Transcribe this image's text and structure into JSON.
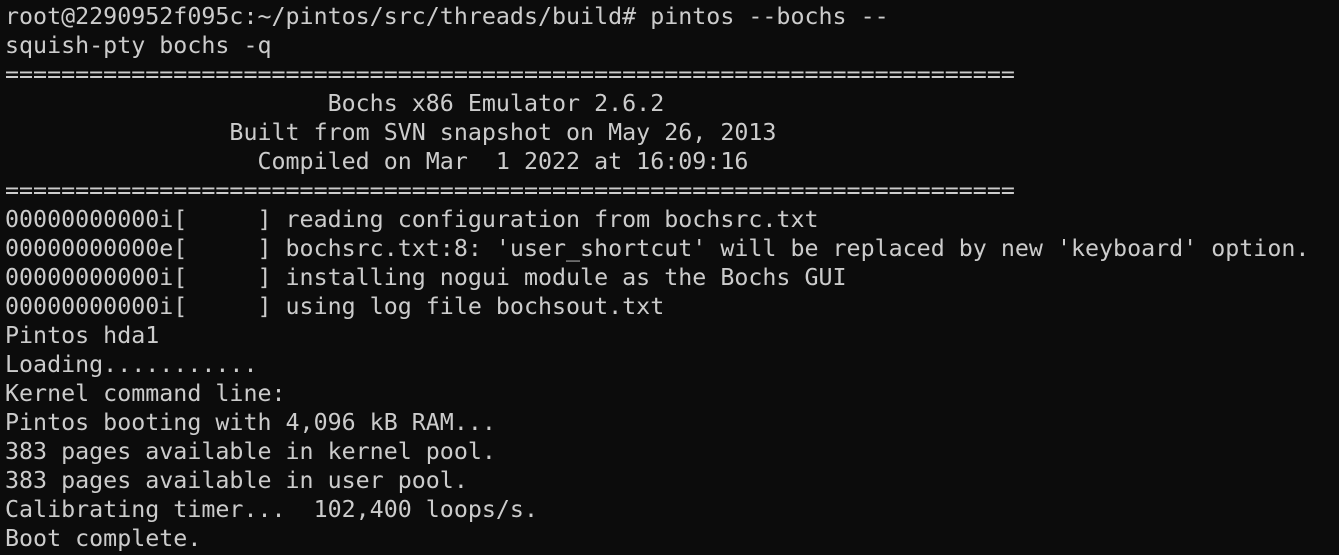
{
  "terminal": {
    "background": "#0c0c0c",
    "foreground": "#cccccc",
    "lines": [
      "root@2290952f095c:~/pintos/src/threads/build# pintos --bochs --",
      "squish-pty bochs -q",
      "========================================================================",
      "                       Bochs x86 Emulator 2.6.2",
      "                Built from SVN snapshot on May 26, 2013",
      "                  Compiled on Mar  1 2022 at 16:09:16",
      "========================================================================",
      "00000000000i[     ] reading configuration from bochsrc.txt",
      "00000000000e[     ] bochsrc.txt:8: 'user_shortcut' will be replaced by new 'keyboard' option.",
      "00000000000i[     ] installing nogui module as the Bochs GUI",
      "00000000000i[     ] using log file bochsout.txt",
      "Pintos hda1",
      "Loading...........",
      "Kernel command line:",
      "Pintos booting with 4,096 kB RAM...",
      "383 pages available in kernel pool.",
      "383 pages available in user pool.",
      "Calibrating timer...  102,400 loops/s.",
      "Boot complete."
    ]
  }
}
